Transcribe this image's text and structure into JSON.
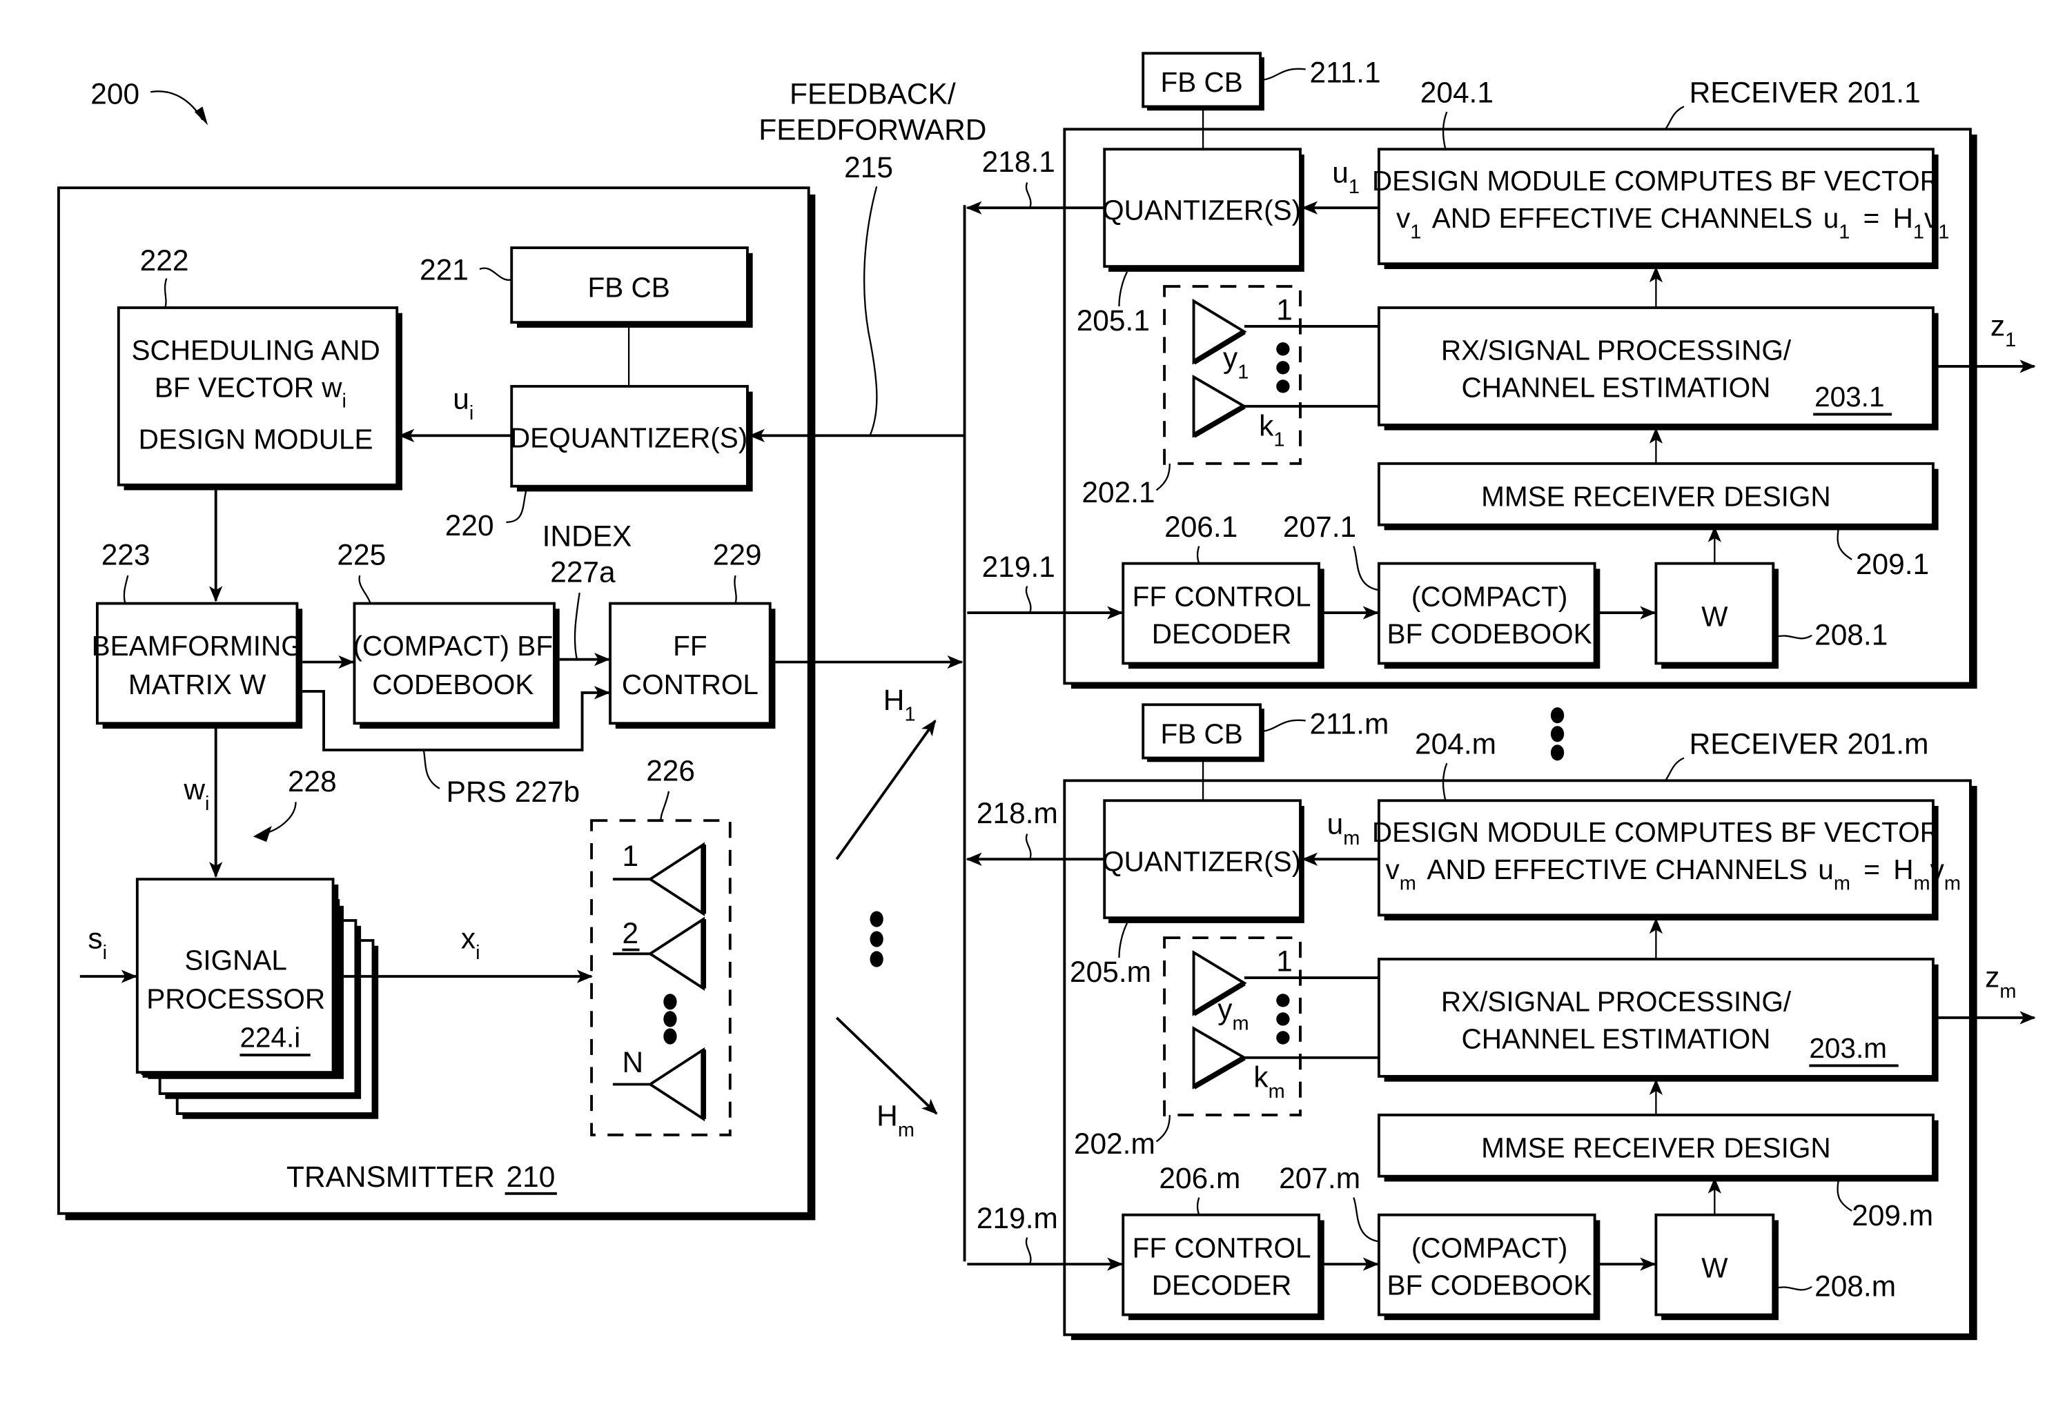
{
  "figure": {
    "ref": "200",
    "feedback_label_line1": "FEEDBACK/",
    "feedback_label_line2": "FEEDFORWARD",
    "feedback_ref": "215",
    "h1": "H",
    "h1_sub": "1",
    "hm": "H",
    "hm_sub": "m"
  },
  "transmitter": {
    "title": "TRANSMITTER",
    "ref": "210",
    "fb_cb": {
      "label": "FB CB",
      "ref": "221"
    },
    "dequantizer": {
      "label": "DEQUANTIZER(S)",
      "ref": "220"
    },
    "scheduling": {
      "line1": "SCHEDULING AND",
      "line2": "BF VECTOR w",
      "line2_sub": "i",
      "line3": "DESIGN MODULE",
      "ref": "222"
    },
    "u_i": "u",
    "u_i_sub": "i",
    "beamforming": {
      "line1": "BEAMFORMING",
      "line2": "MATRIX W",
      "ref": "223"
    },
    "codebook": {
      "line1": "(COMPACT) BF",
      "line2": "CODEBOOK",
      "ref": "225"
    },
    "ff_control": {
      "line1": "FF",
      "line2": "CONTROL",
      "ref": "229"
    },
    "index_label": "INDEX",
    "index_ref": "227a",
    "prs_label": "PRS 227b",
    "w_i": "w",
    "w_i_sub": "i",
    "ref_228": "228",
    "signal_processor": {
      "line1": "SIGNAL",
      "line2": "PROCESSOR",
      "ref": "224.i"
    },
    "s_i": "s",
    "s_i_sub": "i",
    "x_i": "x",
    "x_i_sub": "i",
    "antenna_array_ref": "226",
    "antennas": [
      "1",
      "2",
      "N"
    ]
  },
  "receivers": [
    {
      "title": "RECEIVER 201.1",
      "fb_cb": {
        "label": "FB CB",
        "ref": "211.1"
      },
      "quantizer": {
        "label": "QUANTIZER(S)",
        "ref": "205.1"
      },
      "feedback_ref": "218.1",
      "feedforward_ref": "219.1",
      "u": "u",
      "u_sub": "1",
      "design": {
        "ref": "204.1",
        "line1": "DESIGN MODULE COMPUTES BF VECTOR",
        "v": "v",
        "v_sub": "1",
        "line2": "AND EFFECTIVE CHANNELS",
        "eq_u": "u",
        "eq_u_sub": "1",
        "eq": "=",
        "eq_h": "H",
        "eq_h_sub": "1",
        "eq_v": "v",
        "eq_v_sub": "1"
      },
      "rx": {
        "line1": "RX/SIGNAL PROCESSING/",
        "line2": "CHANNEL ESTIMATION",
        "ref": "203.1"
      },
      "z": "z",
      "z_sub": "1",
      "antenna_ref": "202.1",
      "ant_top": "1",
      "y": "y",
      "y_sub": "1",
      "k": "k",
      "k_sub": "1",
      "mmse": {
        "label": "MMSE RECEIVER DESIGN",
        "ref": "209.1"
      },
      "ff_decoder": {
        "line1": "FF CONTROL",
        "line2": "DECODER",
        "ref": "206.1"
      },
      "codebook": {
        "line1": "(COMPACT)",
        "line2": "BF CODEBOOK",
        "ref": "207.1"
      },
      "w": {
        "label": "W",
        "ref": "208.1"
      }
    },
    {
      "title": "RECEIVER 201.m",
      "fb_cb": {
        "label": "FB CB",
        "ref": "211.m"
      },
      "quantizer": {
        "label": "QUANTIZER(S)",
        "ref": "205.m"
      },
      "feedback_ref": "218.m",
      "feedforward_ref": "219.m",
      "u": "u",
      "u_sub": "m",
      "design": {
        "ref": "204.m",
        "line1": "DESIGN MODULE COMPUTES BF VECTOR",
        "v": "v",
        "v_sub": "m",
        "line2": "AND EFFECTIVE CHANNELS",
        "eq_u": "u",
        "eq_u_sub": "m",
        "eq": "=",
        "eq_h": "H",
        "eq_h_sub": "m",
        "eq_v": "v",
        "eq_v_sub": "m"
      },
      "rx": {
        "line1": "RX/SIGNAL PROCESSING/",
        "line2": "CHANNEL ESTIMATION",
        "ref": "203.m"
      },
      "z": "z",
      "z_sub": "m",
      "antenna_ref": "202.m",
      "ant_top": "1",
      "y": "y",
      "y_sub": "m",
      "k": "k",
      "k_sub": "m",
      "mmse": {
        "label": "MMSE RECEIVER DESIGN",
        "ref": "209.m"
      },
      "ff_decoder": {
        "line1": "FF CONTROL",
        "line2": "DECODER",
        "ref": "206.m"
      },
      "codebook": {
        "line1": "(COMPACT)",
        "line2": "BF CODEBOOK",
        "ref": "207.m"
      },
      "w": {
        "label": "W",
        "ref": "208.m"
      }
    }
  ]
}
